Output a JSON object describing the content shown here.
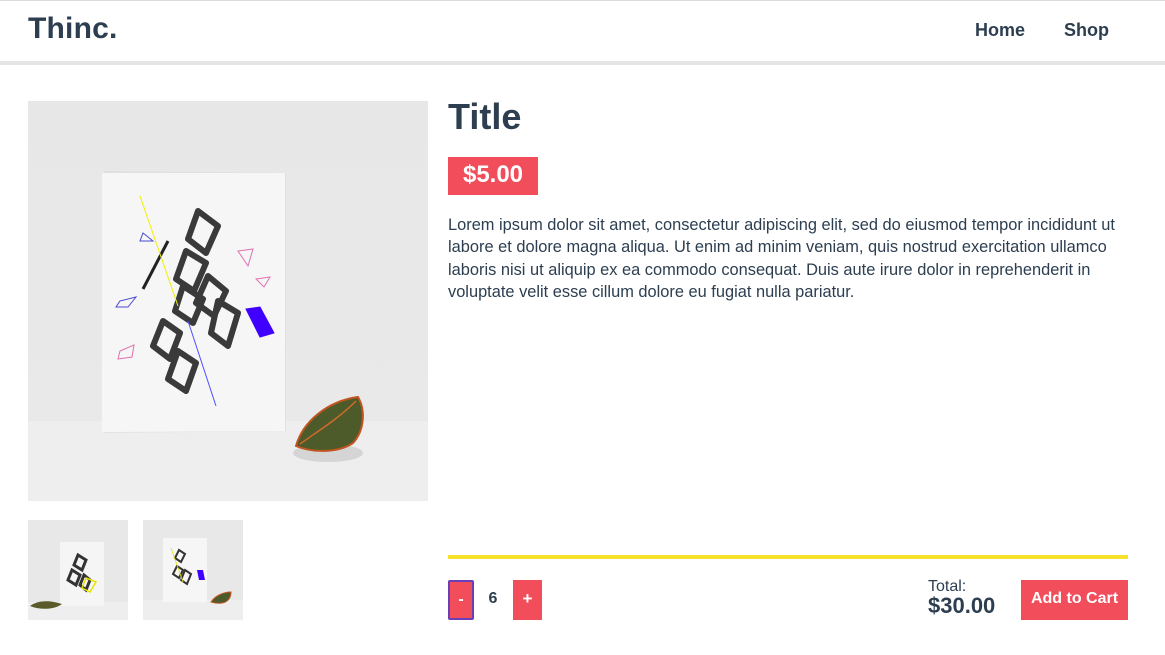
{
  "brand": "Thinc.",
  "nav": {
    "home": "Home",
    "shop": "Shop"
  },
  "product": {
    "title": "Title",
    "price": "$5.00",
    "description": "Lorem ipsum dolor sit amet, consectetur adipiscing elit, sed do eiusmod tempor incididunt ut labore et dolore magna aliqua. Ut enim ad minim veniam, quis nostrud exercitation ullamco laboris nisi ut aliquip ex ea commodo consequat. Duis aute irure dolor in reprehenderit in voluptate velit esse cillum dolore eu fugiat nulla pariatur."
  },
  "cart": {
    "minus_label": "-",
    "quantity": "6",
    "plus_label": "+",
    "total_label": "Total:",
    "total_value": "$30.00",
    "add_label": "Add to Cart"
  },
  "colors": {
    "accent": "#f24d5b",
    "divider": "#f7e12b",
    "text": "#2c3e50"
  }
}
